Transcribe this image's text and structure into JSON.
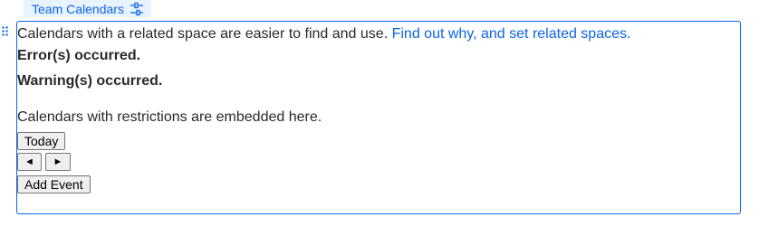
{
  "macro": {
    "tab_label": "Team Calendars",
    "settings_icon": "sliders-icon",
    "drag_icon": "drag-handle-icon"
  },
  "content": {
    "info_text": "Calendars with a related space are easier to find and use.",
    "info_link": "Find out why, and set related spaces.",
    "error_text": "Error(s) occurred.",
    "warning_text": "Warning(s) occurred.",
    "restrictions_text": "Calendars with restrictions are embedded here."
  },
  "buttons": {
    "today": "Today",
    "prev": "◄",
    "next": "►",
    "add_event": "Add Event"
  },
  "colors": {
    "accent": "#0c66e4",
    "tab_background": "#e9f2ff"
  }
}
